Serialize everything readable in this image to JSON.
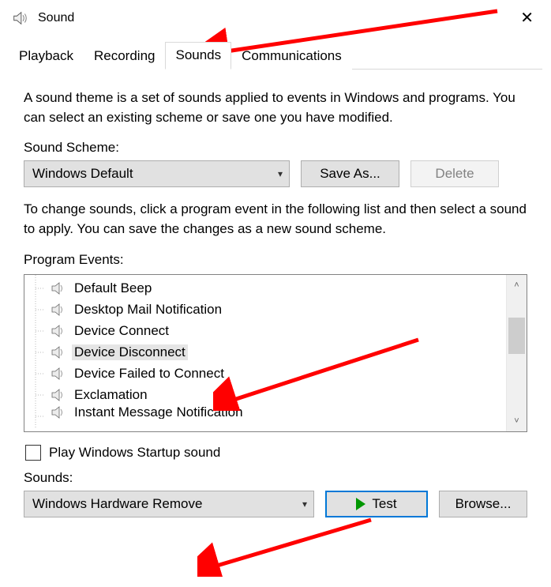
{
  "title": "Sound",
  "tabs": [
    "Playback",
    "Recording",
    "Sounds",
    "Communications"
  ],
  "active_tab": 2,
  "theme_desc": "A sound theme is a set of sounds applied to events in Windows and programs.  You can select an existing scheme or save one you have modified.",
  "scheme_label": "Sound Scheme:",
  "scheme_value": "Windows Default",
  "save_as_label": "Save As...",
  "delete_label": "Delete",
  "change_desc": "To change sounds, click a program event in the following list and then select a sound to apply.  You can save the changes as a new sound scheme.",
  "events_label": "Program Events:",
  "events": [
    {
      "label": "Default Beep",
      "selected": false
    },
    {
      "label": "Desktop Mail Notification",
      "selected": false
    },
    {
      "label": "Device Connect",
      "selected": false
    },
    {
      "label": "Device Disconnect",
      "selected": true
    },
    {
      "label": "Device Failed to Connect",
      "selected": false
    },
    {
      "label": "Exclamation",
      "selected": false
    },
    {
      "label": "Instant Message Notification",
      "selected": false
    }
  ],
  "startup_check_label": "Play Windows Startup sound",
  "startup_checked": false,
  "sounds_label": "Sounds:",
  "sounds_value": "Windows Hardware Remove",
  "test_label": "Test",
  "browse_label": "Browse..."
}
